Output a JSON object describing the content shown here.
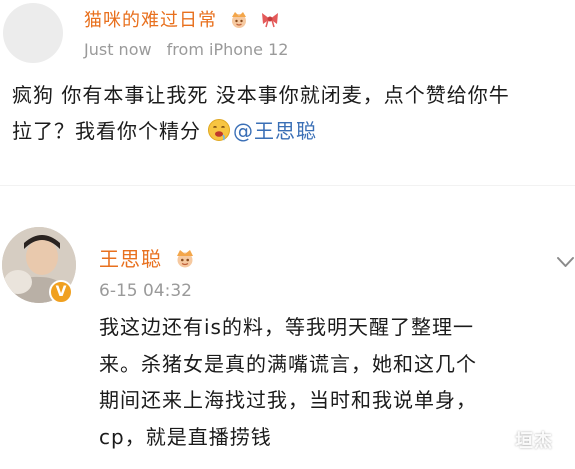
{
  "colors": {
    "username": "#e8701e",
    "meta": "#9a9a9a",
    "mention": "#3a6fb6",
    "text": "#1b1b1b"
  },
  "post1": {
    "username": "猫咪的难过日常",
    "time": "Just now",
    "source": "from iPhone 12",
    "lines": [
      "疯狗 你有本事让我死 没本事你就闭麦，点个赞给你牛",
      "拉了？我看你个精分"
    ],
    "mention": "@王思聪",
    "icons": [
      "crown-badge-icon",
      "bow-badge-icon",
      "drooling-emoji-icon"
    ]
  },
  "post2": {
    "username": "王思聪",
    "time": "6-15 04:32",
    "verified": "V",
    "lines": [
      "我这边还有is的料，等我明天醒了整理一",
      "来。杀猪女是真的满嘴谎言，她和这几个",
      "期间还来上海找过我，当时和我说单身，",
      "cp，就是直播捞钱"
    ],
    "icons": [
      "crown-badge-icon",
      "chevron-down-icon"
    ]
  },
  "watermark": "垣杰"
}
